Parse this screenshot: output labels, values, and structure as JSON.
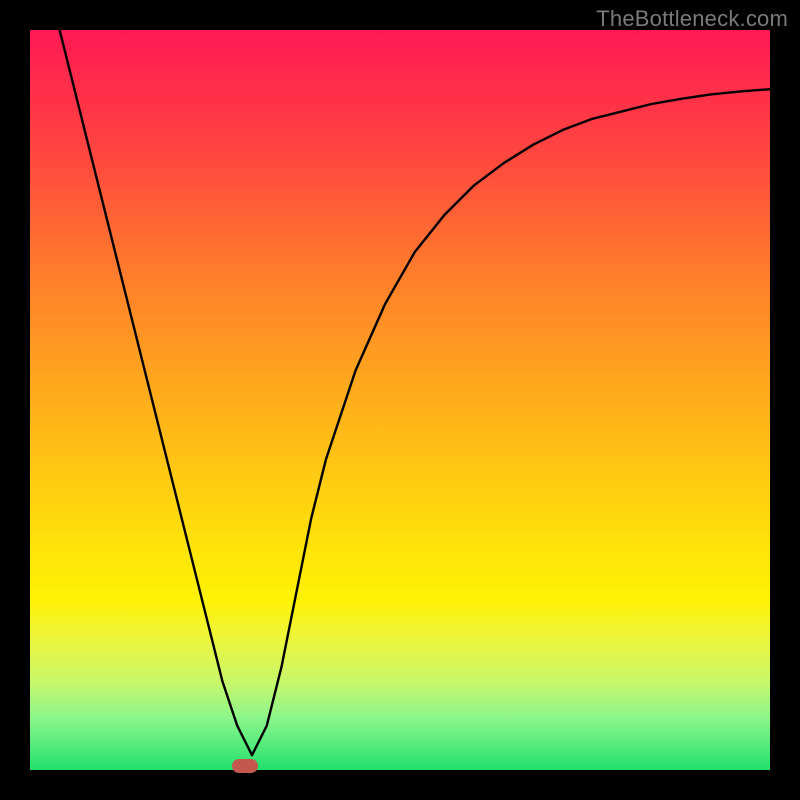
{
  "watermark": {
    "text": "TheBottleneck.com"
  },
  "colors": {
    "frame": "#000000",
    "curve": "#000000",
    "marker": "#c4584e",
    "gradient_top": "#ff1a53",
    "gradient_bottom": "#22e06e"
  },
  "chart_data": {
    "type": "line",
    "title": "",
    "xlabel": "",
    "ylabel": "",
    "xlim": [
      0,
      100
    ],
    "ylim": [
      0,
      100
    ],
    "grid": false,
    "legend": false,
    "note": "Values estimated from pixel positions; y=0 is bottom (green), y=100 is top (red). Chart has no labeled ticks.",
    "series": [
      {
        "name": "curve",
        "x": [
          4,
          6,
          8,
          10,
          12,
          14,
          16,
          18,
          20,
          22,
          24,
          26,
          28,
          30,
          32,
          34,
          36,
          38,
          40,
          44,
          48,
          52,
          56,
          60,
          64,
          68,
          72,
          76,
          80,
          84,
          88,
          92,
          96,
          100
        ],
        "values": [
          100,
          92,
          84,
          76,
          68,
          60,
          52,
          44,
          36,
          28,
          20,
          12,
          6,
          2,
          6,
          14,
          24,
          34,
          42,
          54,
          63,
          70,
          75,
          79,
          82,
          84.5,
          86.5,
          88,
          89,
          90,
          90.7,
          91.3,
          91.7,
          92
        ]
      }
    ],
    "marker": {
      "x": 29,
      "y": 0.5,
      "shape": "pill"
    }
  }
}
